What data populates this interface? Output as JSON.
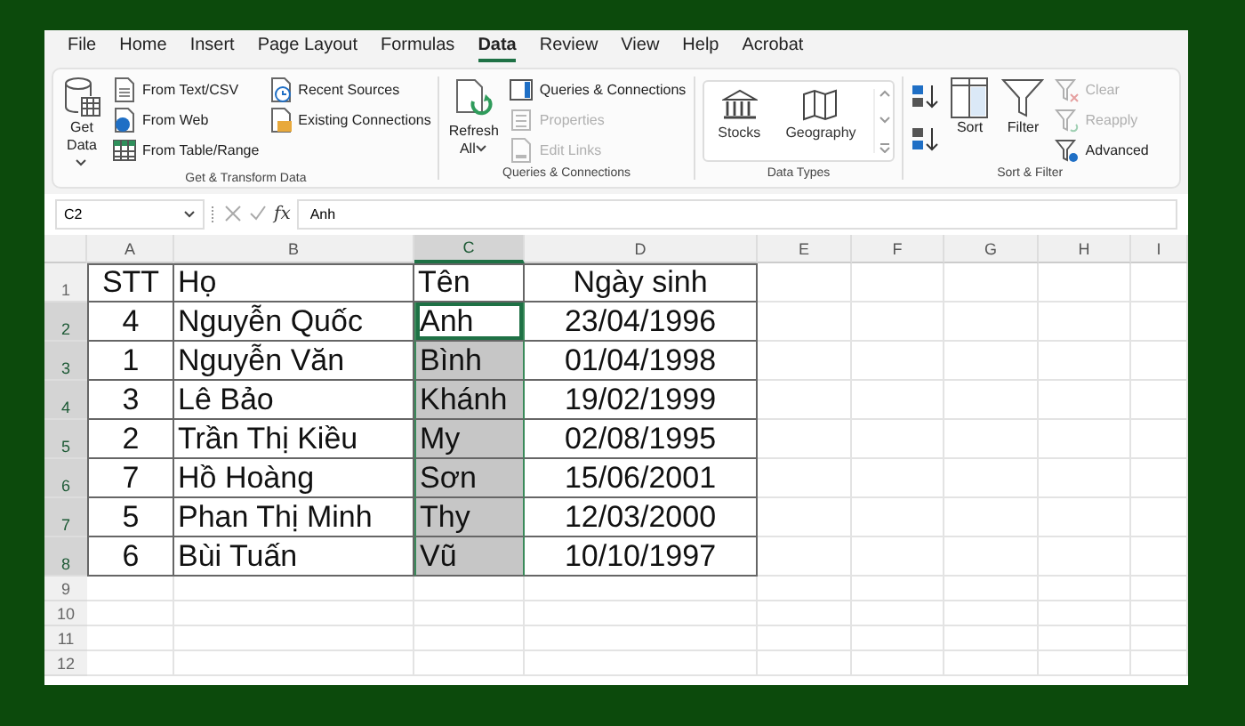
{
  "tabs": [
    {
      "label": "File",
      "selected": false
    },
    {
      "label": "Home",
      "selected": false
    },
    {
      "label": "Insert",
      "selected": false
    },
    {
      "label": "Page Layout",
      "selected": false
    },
    {
      "label": "Formulas",
      "selected": false
    },
    {
      "label": "Data",
      "selected": true
    },
    {
      "label": "Review",
      "selected": false
    },
    {
      "label": "View",
      "selected": false
    },
    {
      "label": "Help",
      "selected": false
    },
    {
      "label": "Acrobat",
      "selected": false
    }
  ],
  "ribbon": {
    "groups": [
      {
        "label": "Get & Transform Data",
        "columns": [
          [
            {
              "kind": "large",
              "label": "Get Data",
              "dropdown": true,
              "disabled": false
            }
          ],
          [
            {
              "kind": "small",
              "label": "From Text/CSV",
              "disabled": false
            },
            {
              "kind": "small",
              "label": "From Web",
              "disabled": false
            },
            {
              "kind": "small",
              "label": "From Table/Range",
              "disabled": false
            }
          ],
          [
            {
              "kind": "small",
              "label": "Recent Sources",
              "disabled": false
            },
            {
              "kind": "small",
              "label": "Existing Connections",
              "disabled": false
            }
          ]
        ]
      },
      {
        "label": "Queries & Connections",
        "columns": [
          [
            {
              "kind": "large",
              "label": "Refresh All",
              "dropdown": true,
              "disabled": false
            }
          ],
          [
            {
              "kind": "small",
              "label": "Queries & Connections",
              "disabled": false
            },
            {
              "kind": "small",
              "label": "Properties",
              "disabled": true
            },
            {
              "kind": "small",
              "label": "Edit Links",
              "disabled": true
            }
          ]
        ]
      },
      {
        "label": "Data Types",
        "columns": [
          [
            {
              "kind": "gallery",
              "options": [
                {
                  "label": "Stocks"
                },
                {
                  "label": "Geography"
                }
              ]
            }
          ]
        ]
      },
      {
        "label": "Sort & Filter",
        "columns": [
          [
            {
              "kind": "icon",
              "disabled": false
            },
            {
              "kind": "icon",
              "disabled": false
            }
          ],
          [
            {
              "kind": "large",
              "label": "Sort",
              "dropdown": false,
              "disabled": false
            }
          ],
          [
            {
              "kind": "large",
              "label": "Filter",
              "dropdown": false,
              "disabled": false
            }
          ],
          [
            {
              "kind": "small",
              "label": "Clear",
              "disabled": true
            },
            {
              "kind": "small",
              "label": "Reapply",
              "disabled": true
            },
            {
              "kind": "small",
              "label": "Advanced",
              "disabled": false
            }
          ]
        ]
      }
    ]
  },
  "formula_bar": {
    "name_box": "C2",
    "fx": "fx",
    "value": "Anh"
  },
  "sheet": {
    "columns": [
      {
        "letter": "A",
        "selected": false
      },
      {
        "letter": "B",
        "selected": false
      },
      {
        "letter": "C",
        "selected": true
      },
      {
        "letter": "D",
        "selected": false
      },
      {
        "letter": "E",
        "selected": false
      },
      {
        "letter": "F",
        "selected": false
      },
      {
        "letter": "G",
        "selected": false
      },
      {
        "letter": "H",
        "selected": false
      },
      {
        "letter": "I",
        "selected": false
      }
    ],
    "rows": [
      {
        "number": "1",
        "selected": false,
        "cells": [
          {
            "text": "STT",
            "selected": false,
            "active": false
          },
          {
            "text": "Họ",
            "selected": false,
            "active": false
          },
          {
            "text": "Tên",
            "selected": false,
            "active": false
          },
          {
            "text": "Ngày sinh",
            "selected": false,
            "active": false
          }
        ]
      },
      {
        "number": "2",
        "selected": true,
        "cells": [
          {
            "text": "4",
            "selected": false,
            "active": false
          },
          {
            "text": "Nguyễn Quốc",
            "selected": false,
            "active": false
          },
          {
            "text": "Anh",
            "selected": true,
            "active": true
          },
          {
            "text": "23/04/1996",
            "selected": false,
            "active": false
          }
        ]
      },
      {
        "number": "3",
        "selected": true,
        "cells": [
          {
            "text": "1",
            "selected": false,
            "active": false
          },
          {
            "text": "Nguyễn Văn",
            "selected": false,
            "active": false
          },
          {
            "text": "Bình",
            "selected": true,
            "active": false
          },
          {
            "text": "01/04/1998",
            "selected": false,
            "active": false
          }
        ]
      },
      {
        "number": "4",
        "selected": true,
        "cells": [
          {
            "text": "3",
            "selected": false,
            "active": false
          },
          {
            "text": "Lê Bảo",
            "selected": false,
            "active": false
          },
          {
            "text": "Khánh",
            "selected": true,
            "active": false
          },
          {
            "text": "19/02/1999",
            "selected": false,
            "active": false
          }
        ]
      },
      {
        "number": "5",
        "selected": true,
        "cells": [
          {
            "text": "2",
            "selected": false,
            "active": false
          },
          {
            "text": "Trần Thị Kiều",
            "selected": false,
            "active": false
          },
          {
            "text": "My",
            "selected": true,
            "active": false
          },
          {
            "text": "02/08/1995",
            "selected": false,
            "active": false
          }
        ]
      },
      {
        "number": "6",
        "selected": true,
        "cells": [
          {
            "text": "7",
            "selected": false,
            "active": false
          },
          {
            "text": "Hồ Hoàng",
            "selected": false,
            "active": false
          },
          {
            "text": "Sơn",
            "selected": true,
            "active": false
          },
          {
            "text": "15/06/2001",
            "selected": false,
            "active": false
          }
        ]
      },
      {
        "number": "7",
        "selected": true,
        "cells": [
          {
            "text": "5",
            "selected": false,
            "active": false
          },
          {
            "text": "Phan Thị Minh",
            "selected": false,
            "active": false
          },
          {
            "text": "Thy",
            "selected": true,
            "active": false
          },
          {
            "text": "12/03/2000",
            "selected": false,
            "active": false
          }
        ]
      },
      {
        "number": "8",
        "selected": true,
        "cells": [
          {
            "text": "6",
            "selected": false,
            "active": false
          },
          {
            "text": "Bùi Tuấn",
            "selected": false,
            "active": false
          },
          {
            "text": "Vũ",
            "selected": true,
            "active": false
          },
          {
            "text": "10/10/1997",
            "selected": false,
            "active": false
          }
        ]
      },
      {
        "number": "9",
        "selected": false,
        "cells": []
      },
      {
        "number": "10",
        "selected": false,
        "cells": []
      },
      {
        "number": "11",
        "selected": false,
        "cells": []
      },
      {
        "number": "12",
        "selected": false,
        "cells": []
      }
    ]
  }
}
